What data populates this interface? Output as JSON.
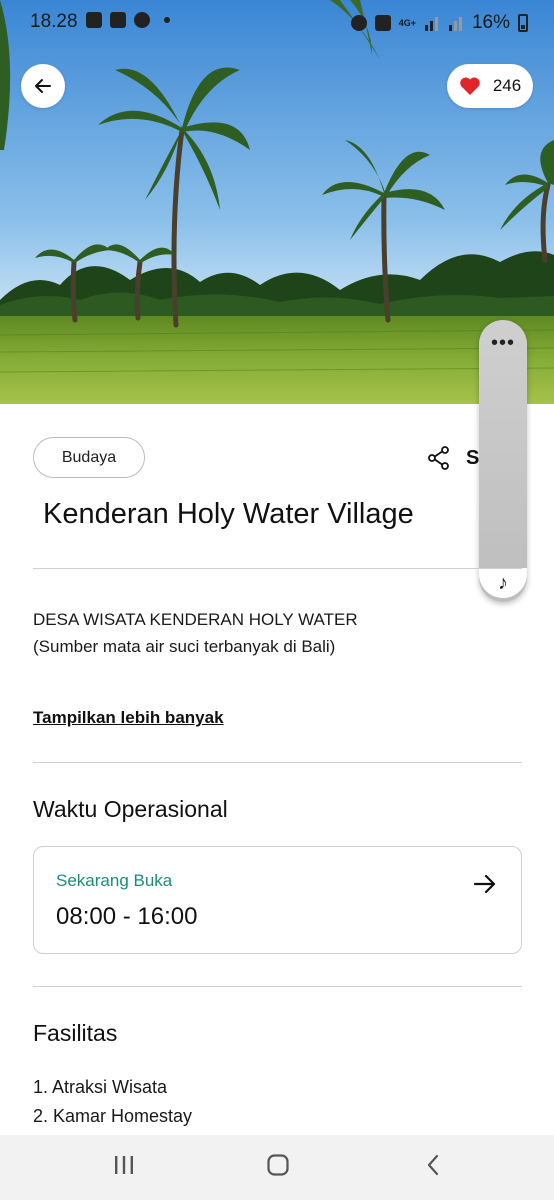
{
  "status_bar": {
    "time": "18.28",
    "signal_label": "4G+",
    "battery": "16%"
  },
  "header": {
    "likes_count": "246",
    "icons": {
      "back": "arrow-left-icon",
      "like": "heart-icon"
    },
    "colors": {
      "heart": "#e0262b"
    }
  },
  "hero": {
    "scene": "rice field with coconut palms",
    "colors": {
      "sky_top": "#3a86d4",
      "sky_bottom": "#bcdcf2",
      "grass": "#6f9a2a"
    }
  },
  "floating_panel": {
    "icons": {
      "top": "more-horizontal-icon",
      "bottom": "music-note-icon"
    }
  },
  "content": {
    "category": "Budaya",
    "share_label": "S",
    "title": "Kenderan Holy Water Village",
    "description_line1": "DESA WISATA KENDERAN HOLY WATER",
    "description_line2": "(Sumber mata air suci terbanyak di Bali)",
    "show_more": "Tampilkan lebih banyak"
  },
  "operational": {
    "heading": "Waktu Operasional",
    "status": "Sekarang Buka",
    "hours": "08:00 - 16:00",
    "colors": {
      "status": "#1d8a7e"
    }
  },
  "facilities": {
    "heading": "Fasilitas",
    "items": [
      "1. Atraksi Wisata",
      "2. Kamar Homestay"
    ]
  },
  "system_nav": {
    "icons": {
      "recents": "recents-icon",
      "home": "home-icon",
      "back": "nav-back-icon"
    }
  }
}
